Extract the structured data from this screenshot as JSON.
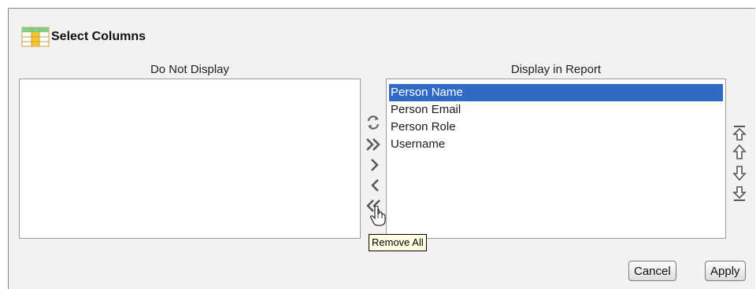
{
  "header": {
    "title": "Select Columns",
    "icon": "table-columns-icon"
  },
  "left_list": {
    "label": "Do Not Display",
    "items": []
  },
  "right_list": {
    "label": "Display in Report",
    "items": [
      "Person Name",
      "Person Email",
      "Person Role",
      "Username"
    ],
    "selected": "Person Name"
  },
  "transfer_controls": [
    "reset-icon",
    "move-all-icon",
    "move-icon",
    "remove-icon",
    "remove-all-icon"
  ],
  "order_controls": [
    "move-top-icon",
    "move-up-icon",
    "move-down-icon",
    "move-bottom-icon"
  ],
  "tooltip": {
    "text": "Remove All"
  },
  "buttons": {
    "cancel": "Cancel",
    "apply": "Apply"
  },
  "colors": {
    "selected_bg": "#3169c6",
    "panel_bg": "#f2f2f2",
    "icon": "#555555"
  }
}
